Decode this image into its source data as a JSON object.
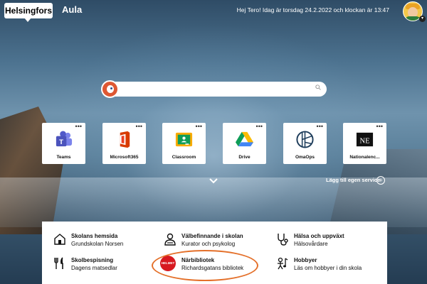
{
  "header": {
    "brand": "Helsingfors",
    "app_title": "Aula",
    "greeting": "Hej Tero! Idag är torsdag 24.2.2022 och klockan är 13:47"
  },
  "search": {
    "placeholder": ""
  },
  "tiles": [
    {
      "label": "Teams",
      "icon": "teams-icon",
      "menu": "•••"
    },
    {
      "label": "Microsoft365",
      "icon": "microsoft365-icon",
      "menu": "•••"
    },
    {
      "label": "Classroom",
      "icon": "classroom-icon",
      "menu": "•••"
    },
    {
      "label": "Drive",
      "icon": "drive-icon",
      "menu": "•••"
    },
    {
      "label": "OmaOps",
      "icon": "omaops-icon",
      "menu": "•••"
    },
    {
      "label": "Nationalenc...",
      "icon": "ne-icon",
      "menu": "•••"
    }
  ],
  "tile_logo_text": {
    "ne": "NE"
  },
  "add_service": "Lägg till egen service",
  "links": [
    {
      "title": "Skolans hemsida",
      "sub": "Grundskolan Norsen",
      "icon": "school-icon"
    },
    {
      "title": "Välbefinnande i skolan",
      "sub": "Kurator och psykolog",
      "icon": "counselor-icon"
    },
    {
      "title": "Hälsa och uppväxt",
      "sub": "Hälsovårdare",
      "icon": "stethoscope-icon"
    },
    {
      "title": "Skolbespisning",
      "sub": "Dagens matsedlar",
      "icon": "cutlery-icon"
    },
    {
      "title": "Närbibliotek",
      "sub": "Richardsgatans  bibliotek",
      "icon": "helmet-library-icon",
      "badge": "HELMET"
    },
    {
      "title": "Hobbyer",
      "sub": "Läs om hobbyer i din skola",
      "icon": "hobby-icon"
    }
  ],
  "colors": {
    "highlight": "#e4702a",
    "ddg": "#de5833",
    "helmet": "#d71920"
  }
}
